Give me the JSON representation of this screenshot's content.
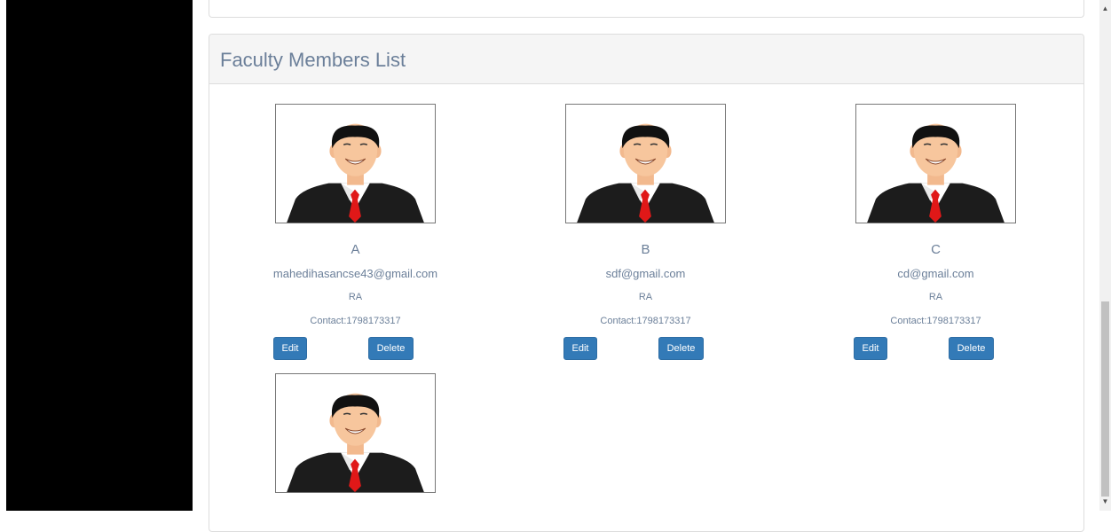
{
  "panel": {
    "title": "Faculty Members List"
  },
  "members": [
    {
      "name": "A",
      "email": "mahedihasancse43@gmail.com",
      "role": "RA",
      "contact": "Contact:1798173317",
      "edit_label": "Edit",
      "delete_label": "Delete"
    },
    {
      "name": "B",
      "email": "sdf@gmail.com",
      "role": "RA",
      "contact": "Contact:1798173317",
      "edit_label": "Edit",
      "delete_label": "Delete"
    },
    {
      "name": "C",
      "email": "cd@gmail.com",
      "role": "RA",
      "contact": "Contact:1798173317",
      "edit_label": "Edit",
      "delete_label": "Delete"
    }
  ],
  "scrollbar": {
    "up_icon": "▲",
    "down_icon": "▼"
  },
  "colors": {
    "button": "#337ab7",
    "title_text": "#6b7f99",
    "sidebar": "#000000"
  }
}
